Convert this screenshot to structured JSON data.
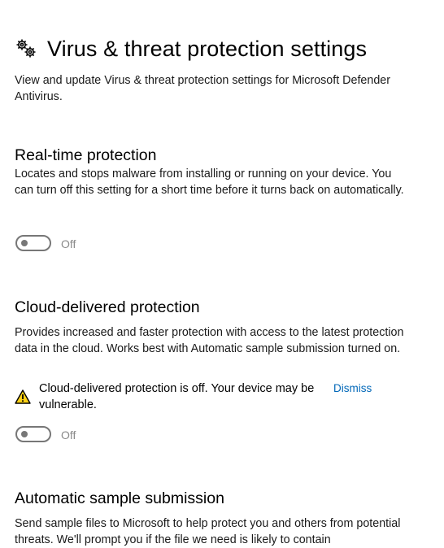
{
  "header": {
    "title": "Virus & threat protection settings",
    "icon": "gears-icon",
    "description": "View and update Virus & threat protection settings for Microsoft Defender Antivirus."
  },
  "realtime": {
    "heading": "Real-time protection",
    "description": "Locates and stops malware from installing or running on your device. You can turn off this setting for a short time before it turns back on automatically.",
    "toggle_state": "Off"
  },
  "cloud": {
    "heading": "Cloud-delivered protection",
    "description": "Provides increased and faster protection with access to the latest protection data in the cloud. Works best with Automatic sample submission turned on.",
    "warning": "Cloud-delivered protection is off. Your device may be vulnerable.",
    "warning_icon": "warning-icon",
    "dismiss_label": "Dismiss",
    "toggle_state": "Off"
  },
  "sample": {
    "heading": "Automatic sample submission",
    "description": "Send sample files to Microsoft to help protect you and others from potential threats. We'll prompt you if the file we need is likely to contain"
  },
  "colors": {
    "link": "#0067b8",
    "warning_fill": "#fcd116",
    "toggle_off": "#777777"
  }
}
